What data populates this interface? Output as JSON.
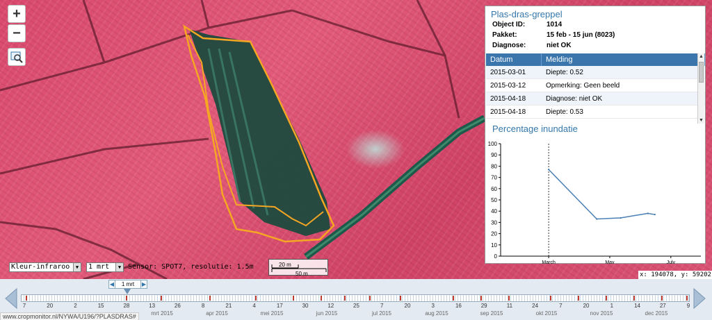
{
  "map": {
    "zoom_in_label": "+",
    "zoom_out_label": "−"
  },
  "info": {
    "title": "Plas-dras-greppel",
    "properties": [
      {
        "label": "Object ID:",
        "value": "1014"
      },
      {
        "label": "Pakket:",
        "value": "15 feb - 15 jun (8023)"
      },
      {
        "label": "Diagnose:",
        "value": "niet OK"
      }
    ],
    "table": {
      "headers": [
        "Datum",
        "Melding"
      ],
      "rows": [
        [
          "2015-03-01",
          "Diepte: 0.52"
        ],
        [
          "2015-03-12",
          "Opmerking: Geen beeld"
        ],
        [
          "2015-04-18",
          "Diagnose: niet OK"
        ],
        [
          "2015-04-18",
          "Diepte: 0.53"
        ]
      ]
    },
    "chart_title": "Percentage inundatie"
  },
  "chart_data": {
    "type": "line",
    "title": "Percentage inundatie",
    "xlabel": "",
    "ylabel": "",
    "ylim": [
      0,
      100
    ],
    "yticks": [
      0,
      10,
      20,
      30,
      40,
      50,
      60,
      70,
      80,
      90,
      100
    ],
    "xticks": [
      "March",
      "May",
      "July"
    ],
    "series": [
      {
        "x": [
          "2015-03-01",
          "2015-04-18",
          "2015-05-12",
          "2015-06-08",
          "2015-06-15"
        ],
        "values": [
          77,
          33,
          34,
          38,
          37
        ]
      }
    ],
    "reference_line": "2015-03-01",
    "grid": false,
    "color": "#4a7fb5"
  },
  "controls": {
    "layer": "Kleur-infraroo",
    "date": "1 mrt",
    "sensor": "Sensor: SPOT7, resolutie: 1.5m",
    "scale_top": "20 m",
    "scale_bottom": "50 m",
    "coords": "x: 194078, y: 592021"
  },
  "timeline": {
    "cursor_label": "1 mrt",
    "tick_labels": [
      "7",
      "20",
      "2",
      "15",
      "28",
      "13",
      "26",
      "8",
      "21",
      "4",
      "17",
      "30",
      "12",
      "25",
      "7",
      "20",
      "3",
      "16",
      "29",
      "11",
      "24",
      "7",
      "20",
      "1",
      "14",
      "27",
      "9"
    ],
    "month_labels": [
      "mrt 2015",
      "apr 2015",
      "mei 2015",
      "jun 2015",
      "jul 2015",
      "aug 2015",
      "sep 2015",
      "okt 2015",
      "nov 2015",
      "dec 2015"
    ],
    "status_url": "www.cropmonitor.nl/NYWA/U196/?PLASDRAS#"
  },
  "colors": {
    "accent": "#3377aa",
    "table_header": "#3a76ac",
    "polygon": "#f5a623",
    "field": "#d94a6e",
    "water": "#1d5a4c"
  }
}
